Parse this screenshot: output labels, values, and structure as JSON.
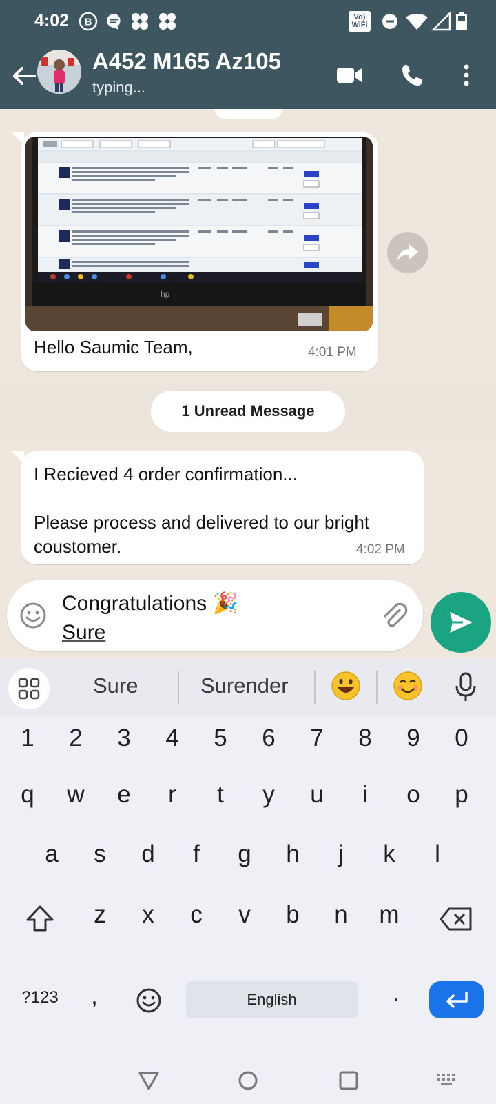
{
  "status_bar": {
    "time": "4:02",
    "volte_badge": "Vo) WiFi"
  },
  "header": {
    "contact_name": "A452 M165 Az105",
    "contact_status": "typing..."
  },
  "messages": [
    {
      "type": "image",
      "caption": "Hello Saumic Team,",
      "time": "4:01 PM"
    },
    {
      "type": "text",
      "text": "I Recieved 4 order confirmation...\n\nPlease process and delivered to our bright coustomer.",
      "time": "4:02 PM"
    }
  ],
  "unread_label": "1 Unread Message",
  "composer": {
    "line1": "Congratulations 🎉",
    "line2": "Sure"
  },
  "keyboard": {
    "suggestions": [
      "Sure",
      "Surender"
    ],
    "suggestion_emojis": [
      "😃",
      "😊"
    ],
    "number_row": [
      "1",
      "2",
      "3",
      "4",
      "5",
      "6",
      "7",
      "8",
      "9",
      "0"
    ],
    "row1": [
      "q",
      "w",
      "e",
      "r",
      "t",
      "y",
      "u",
      "i",
      "o",
      "p"
    ],
    "row2": [
      "a",
      "s",
      "d",
      "f",
      "g",
      "h",
      "j",
      "k",
      "l"
    ],
    "row3": [
      "z",
      "x",
      "c",
      "v",
      "b",
      "n",
      "m"
    ],
    "symbols_key": "?123",
    "comma_key": ",",
    "space_label": "English",
    "period_key": "."
  },
  "colors": {
    "header": "#3d5660",
    "send": "#1aa481",
    "enter": "#1a73e8",
    "chat_bg": "#efe7de"
  }
}
